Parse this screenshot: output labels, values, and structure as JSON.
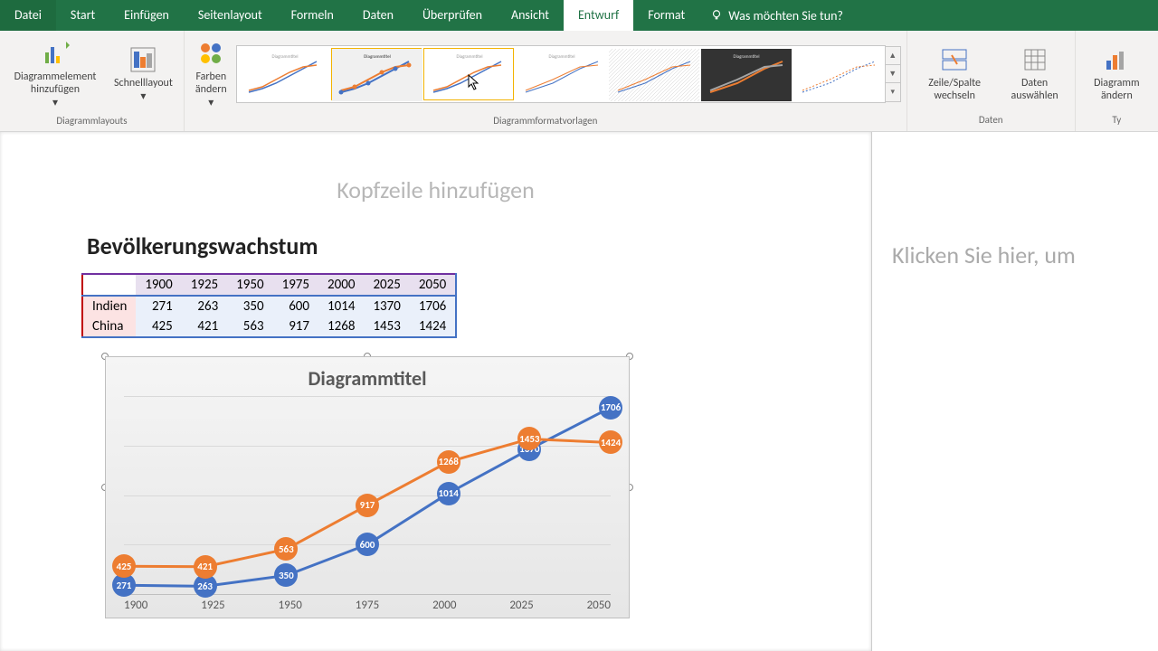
{
  "tabs": {
    "file": "Datei",
    "home": "Start",
    "insert": "Einfügen",
    "layout": "Seitenlayout",
    "formulas": "Formeln",
    "data": "Daten",
    "review": "Überprüfen",
    "view": "Ansicht",
    "design": "Entwurf",
    "format": "Format"
  },
  "tellme": "Was möchten Sie tun?",
  "ribbon": {
    "addElement": "Diagrammelement hinzufügen",
    "quickLayout": "Schnelllayout",
    "changeColors": "Farben ändern",
    "groupLayouts": "Diagrammlayouts",
    "groupStyles": "Diagrammformatvorlagen",
    "groupData": "Daten",
    "switchRowCol": "Zeile/Spalte wechseln",
    "selectData": "Daten auswählen",
    "changeType": "Diagramm ändern"
  },
  "doc": {
    "headerPlaceholder": "Kopfzeile hinzufügen",
    "title": "Bevölkerungswachstum",
    "sidePlaceholder": "Klicken Sie hier, um"
  },
  "chart_data": {
    "type": "line",
    "title": "Diagrammtitel",
    "categories": [
      "1900",
      "1925",
      "1950",
      "1975",
      "2000",
      "2025",
      "2050"
    ],
    "series": [
      {
        "name": "Indien",
        "values": [
          271,
          263,
          350,
          600,
          1014,
          1370,
          1706
        ],
        "color": "#4472c4"
      },
      {
        "name": "China",
        "values": [
          425,
          421,
          563,
          917,
          1268,
          1453,
          1424
        ],
        "color": "#ed7d31"
      }
    ],
    "ylim": [
      200,
      1800
    ]
  }
}
